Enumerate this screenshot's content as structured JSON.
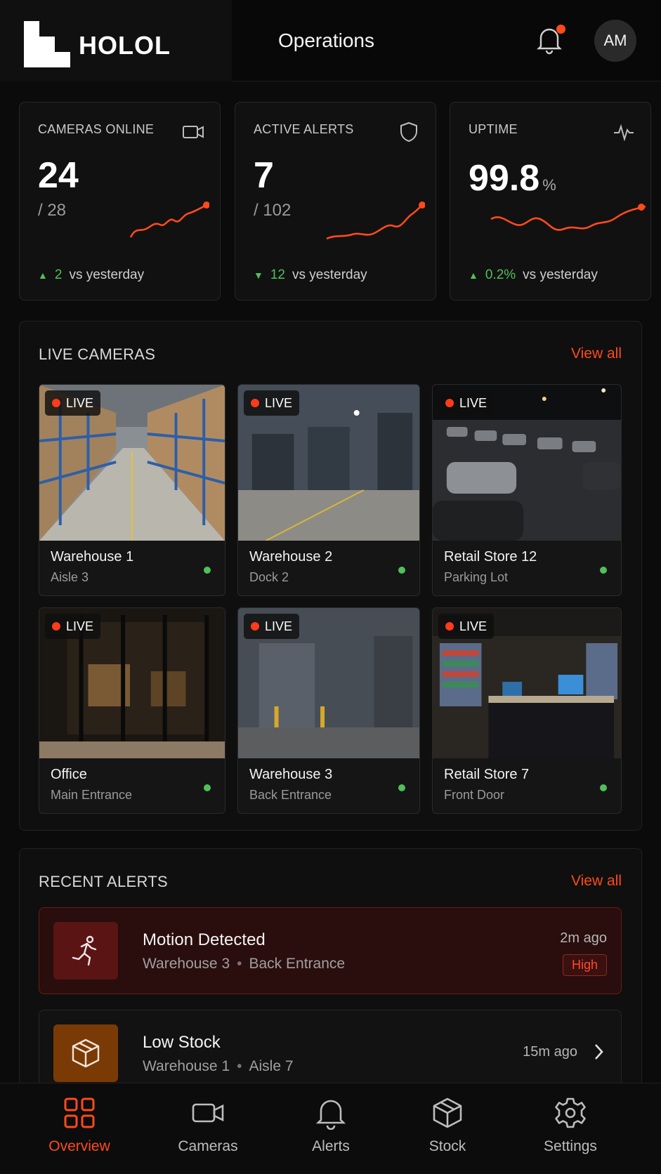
{
  "app": {
    "logo_text": "HOLOL",
    "title": "Operations",
    "avatar_initials": "AM"
  },
  "stats": [
    {
      "label": "CAMERAS ONLINE",
      "value": "24",
      "sub": "/ 28",
      "trend_dir": "up",
      "trend_value": "2",
      "trend_text": "vs yesterday",
      "icon": "video-camera-icon"
    },
    {
      "label": "ACTIVE ALERTS",
      "value": "7",
      "sub": "/ 102",
      "trend_dir": "down",
      "trend_value": "12",
      "trend_text": "vs yesterday",
      "icon": "shield-icon"
    },
    {
      "label": "UPTIME",
      "value": "99.8",
      "unit": "%",
      "trend_dir": "up",
      "trend_value": "0.2%",
      "trend_text": "vs yesterday",
      "icon": "activity-pulse-icon"
    }
  ],
  "live_cameras": {
    "title": "LIVE CAMERAS",
    "view_all": "View all",
    "live_label": "LIVE",
    "items": [
      {
        "name": "Warehouse 1",
        "location": "Aisle 3",
        "scene": "warehouse-aisle"
      },
      {
        "name": "Warehouse 2",
        "location": "Dock 2",
        "scene": "loading-dock"
      },
      {
        "name": "Retail Store 12",
        "location": "Parking Lot",
        "scene": "parking-lot"
      },
      {
        "name": "Office",
        "location": "Main Entrance",
        "scene": "office-entrance"
      },
      {
        "name": "Warehouse 3",
        "location": "Back Entrance",
        "scene": "back-entrance"
      },
      {
        "name": "Retail Store 7",
        "location": "Front Door",
        "scene": "retail-interior"
      }
    ]
  },
  "recent_alerts": {
    "title": "RECENT ALERTS",
    "view_all": "View all",
    "items": [
      {
        "title": "Motion Detected",
        "site": "Warehouse 3",
        "location": "Back Entrance",
        "time": "2m ago",
        "severity": "High",
        "icon": "running-person-icon"
      },
      {
        "title": "Low Stock",
        "site": "Warehouse 1",
        "location": "Aisle 7",
        "time": "15m ago",
        "icon": "box-icon"
      }
    ]
  },
  "nav": [
    {
      "label": "Overview",
      "icon": "grid-icon",
      "active": true
    },
    {
      "label": "Cameras",
      "icon": "video-camera-icon"
    },
    {
      "label": "Alerts",
      "icon": "bell-icon"
    },
    {
      "label": "Stock",
      "icon": "box-icon"
    },
    {
      "label": "Settings",
      "icon": "gear-icon"
    }
  ],
  "colors": {
    "accent": "#ff4a1c",
    "positive": "#4fc15a",
    "background": "#0b0b0b",
    "card": "#111111"
  }
}
